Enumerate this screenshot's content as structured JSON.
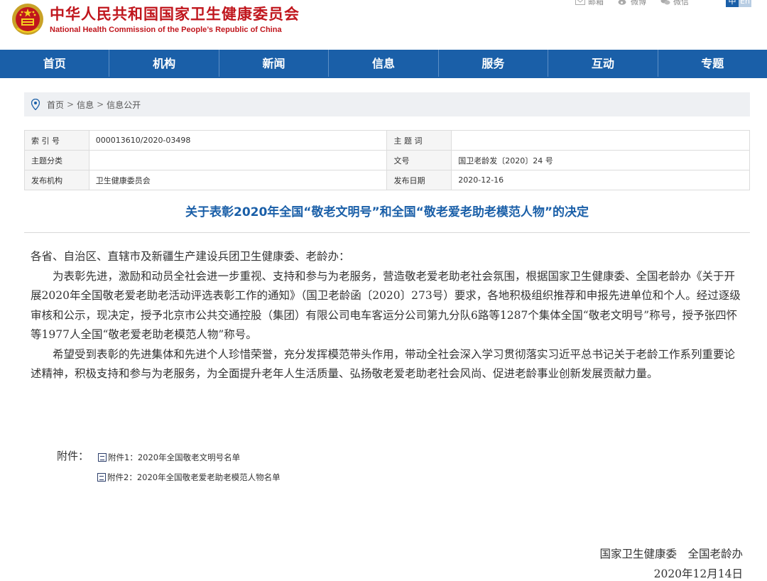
{
  "header": {
    "title": "中华人民共和国国家卫生健康委员会",
    "subtitle": "National Health Commission of the People’s Republic of China",
    "top_links": [
      {
        "label": "邮箱",
        "icon": "mail-icon"
      },
      {
        "label": "微博",
        "icon": "weibo-icon"
      },
      {
        "label": "微信",
        "icon": "wechat-icon"
      }
    ],
    "lang_zh": "中",
    "lang_en": "En"
  },
  "nav": {
    "items": [
      "首页",
      "机构",
      "新闻",
      "信息",
      "服务",
      "互动",
      "专题"
    ]
  },
  "breadcrumb": {
    "items": [
      "首页",
      "信息",
      "信息公开"
    ],
    "separator": ">"
  },
  "info": {
    "index_label": "索 引 号",
    "index_value": "000013610/2020-03498",
    "subject_word_label": "主 题 词",
    "subject_word_value": "",
    "category_label": "主题分类",
    "category_value": "",
    "doc_no_label": "文号",
    "doc_no_value": "国卫老龄发〔2020〕24 号",
    "issuer_label": "发布机构",
    "issuer_value": "卫生健康委员会",
    "date_label": "发布日期",
    "date_value": "2020-12-16"
  },
  "document": {
    "title": "关于表彰2020年全国“敬老文明号”和全国“敬老爱老助老模范人物”的决定",
    "salutation": "各省、自治区、直辖市及新疆生产建设兵团卫生健康委、老龄办：",
    "paragraph1": "为表彰先进，激励和动员全社会进一步重视、支持和参与为老服务，营造敬老爱老助老社会氛围，根据国家卫生健康委、全国老龄办《关于开展2020年全国敬老爱老助老活动评选表彰工作的通知》（国卫老龄函〔2020〕273号）要求，各地积极组织推荐和申报先进单位和个人。经过逐级审核和公示，现决定，授予北京市公共交通控股（集团）有限公司电车客运分公司第九分队6路等1287个集体全国“敬老文明号”称号，授予张四怀等1977人全国“敬老爱老助老模范人物”称号。",
    "paragraph2": "希望受到表彰的先进集体和先进个人珍惜荣誉，充分发挥模范带头作用，带动全社会深入学习贯彻落实习近平总书记关于老龄工作系列重要论述精神，积极支持和参与为老服务，为全面提升老年人生活质量、弘扬敬老爱老助老社会风尚、促进老龄事业创新发展贡献力量。",
    "attachments_label": "附件：",
    "attachment1": "附件1：2020年全国敬老文明号名单",
    "attachment2": "附件2：2020年全国敬老爱老助老模范人物名单",
    "signature": "国家卫生健康委　全国老龄办",
    "sign_date": "2020年12月14日"
  },
  "colors": {
    "brand_red": "#c0161d",
    "nav_blue": "#1a5fa8",
    "title_blue": "#1a5fa8"
  }
}
